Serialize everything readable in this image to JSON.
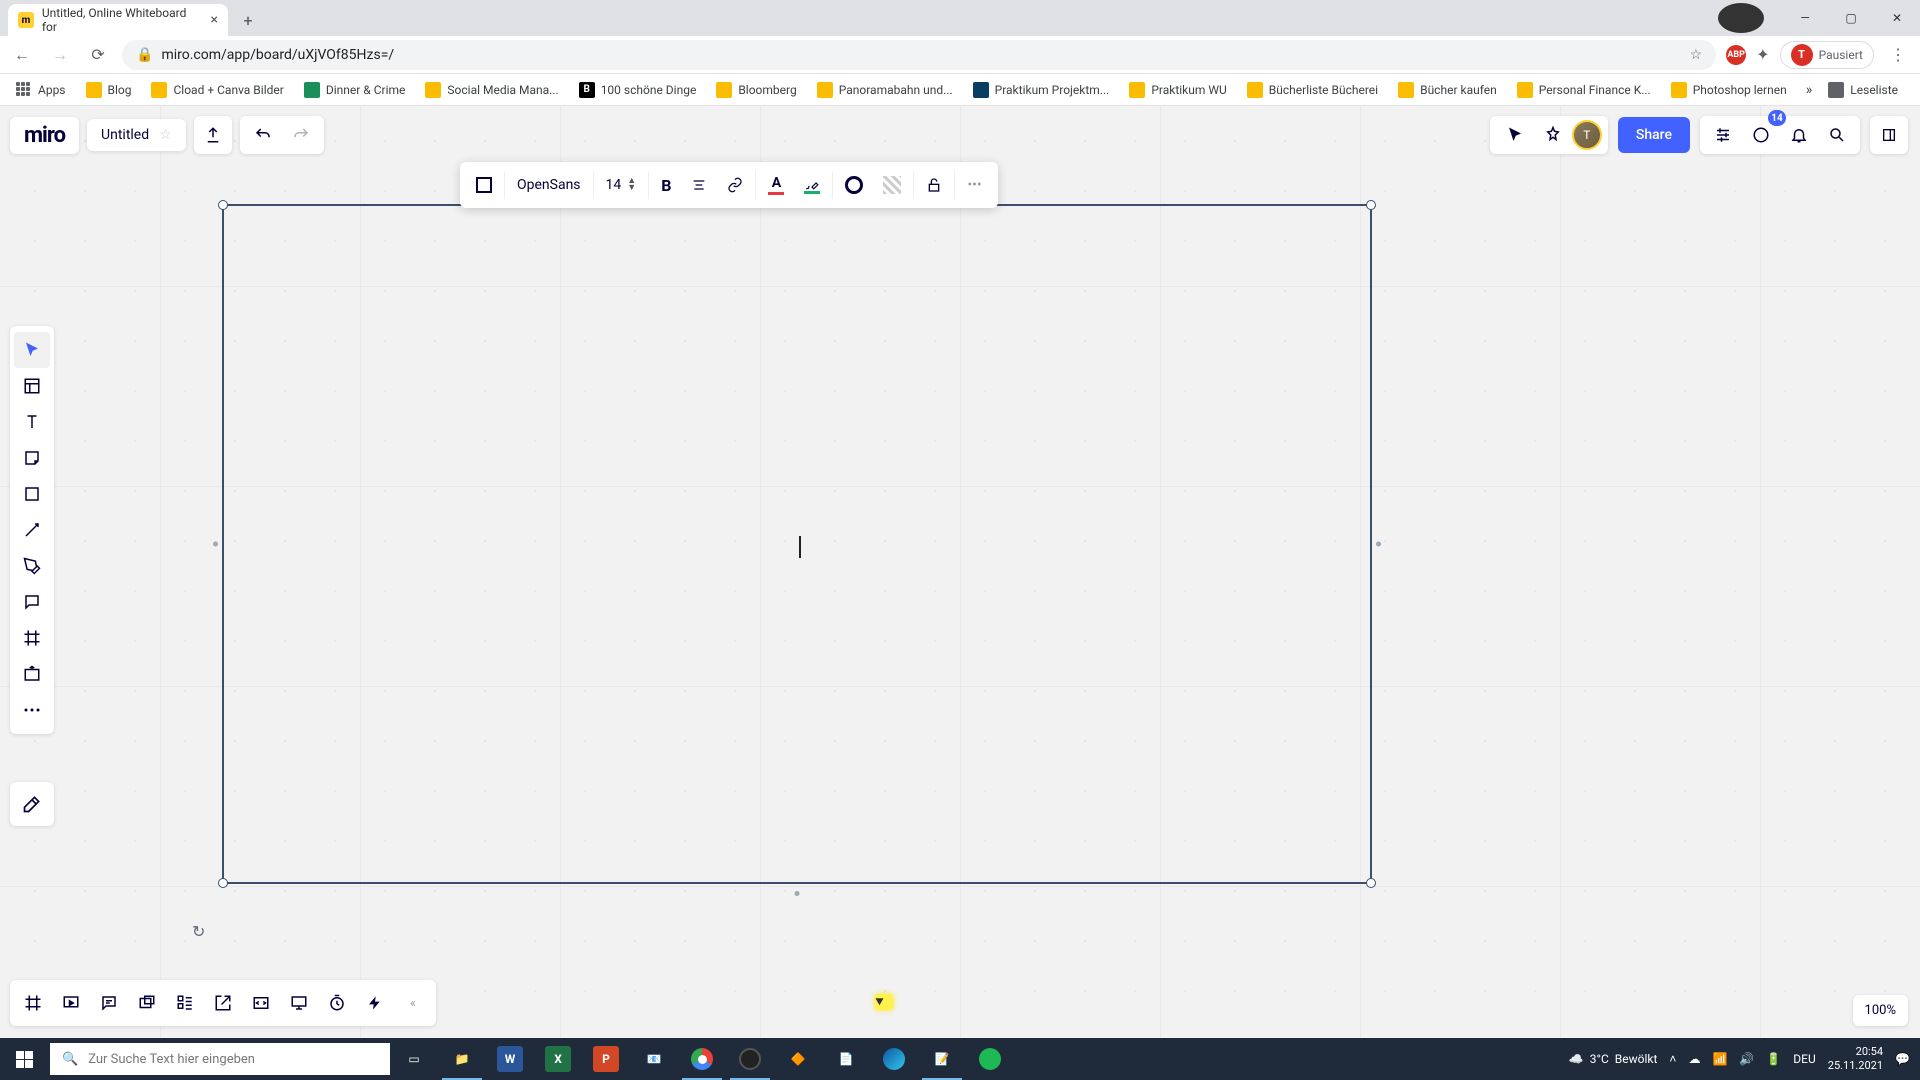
{
  "browser": {
    "tab_title": "Untitled, Online Whiteboard for",
    "url": "miro.com/app/board/uXjVOf85Hzs=/",
    "profile_state": "Pausiert",
    "bookmarks": [
      "Apps",
      "Blog",
      "Cload + Canva Bilder",
      "Dinner & Crime",
      "Social Media Mana...",
      "100 schöne Dinge",
      "Bloomberg",
      "Panoramabahn und...",
      "Praktikum Projektm...",
      "Praktikum WU",
      "Bücherliste Bücherei",
      "Bücher kaufen",
      "Personal Finance K...",
      "Photoshop lernen"
    ],
    "reading_list": "Leseliste"
  },
  "miro": {
    "logo": "miro",
    "board_title": "Untitled",
    "share_label": "Share",
    "notif_count": "14",
    "ctx": {
      "font": "OpenSans",
      "font_size": "14"
    },
    "zoom": "100%"
  },
  "taskbar": {
    "search_placeholder": "Zur Suche Text hier eingeben",
    "weather_temp": "3°C",
    "weather_cond": "Bewölkt",
    "lang": "DEU",
    "time": "20:54",
    "date": "25.11.2021"
  }
}
